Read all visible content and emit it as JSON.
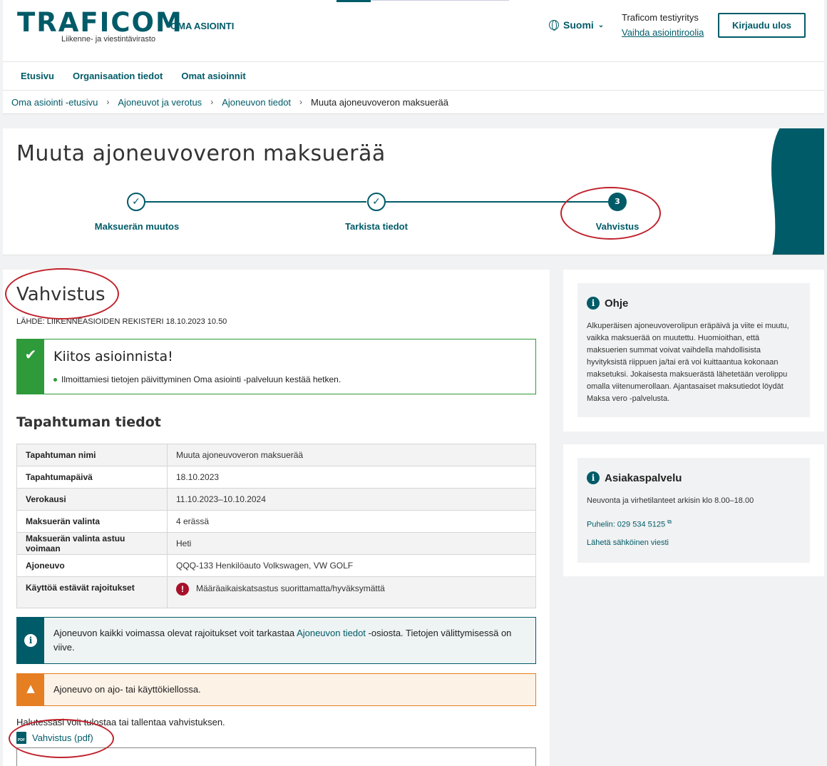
{
  "header": {
    "logo_text": "TRAFICOM",
    "logo_subtitle": "Liikenne- ja viestintävirasto",
    "app_name": "OMA ASIOINTI",
    "language": "Suomi",
    "user_company": "Traficom testiyritys",
    "switch_role_link": "Vaihda asiointiroolia",
    "logout_button": "Kirjaudu ulos"
  },
  "nav": {
    "items": [
      {
        "label": "Etusivu"
      },
      {
        "label": "Organisaation tiedot"
      },
      {
        "label": "Omat asioinnit"
      }
    ]
  },
  "breadcrumb": {
    "items": [
      {
        "label": "Oma asiointi -etusivu"
      },
      {
        "label": "Ajoneuvot ja verotus"
      },
      {
        "label": "Ajoneuvon tiedot"
      }
    ],
    "current": "Muuta ajoneuvoveron maksuerää"
  },
  "hero": {
    "title": "Muuta ajoneuvoveron maksuerää",
    "steps": [
      {
        "label": "Maksuerän muutos",
        "state": "done"
      },
      {
        "label": "Tarkista tiedot",
        "state": "done"
      },
      {
        "label": "Vahvistus",
        "state": "current",
        "number": "3"
      }
    ]
  },
  "main": {
    "title": "Vahvistus",
    "source": "LÄHDE: LIIKENNEASIOIDEN REKISTERI 18.10.2023 10.50",
    "success": {
      "title": "Kiitos asioinnista!",
      "message": "Ilmoittamiesi tietojen päivittyminen Oma asiointi -palveluun kestää hetken."
    },
    "section_title": "Tapahtuman tiedot",
    "details": [
      {
        "key": "Tapahtuman nimi",
        "value": "Muuta ajoneuvoveron maksuerää"
      },
      {
        "key": "Tapahtumapäivä",
        "value": "18.10.2023"
      },
      {
        "key": "Verokausi",
        "value": "11.10.2023–10.10.2024"
      },
      {
        "key": "Maksuerän valinta",
        "value": "4 erässä"
      },
      {
        "key": "Maksuerän valinta astuu voimaan",
        "value": "Heti"
      },
      {
        "key": "Ajoneuvo",
        "value": "QQQ-133 Henkilöauto Volkswagen, VW GOLF"
      },
      {
        "key": "Käyttöä estävät rajoitukset",
        "value": "Määräaikaiskatsastus suorittamatta/hyväksymättä"
      }
    ],
    "info": {
      "text_before": "Ajoneuvon kaikki voimassa olevat rajoitukset voit tarkastaa ",
      "link": "Ajoneuvon tiedot",
      "text_after": " -osiosta. Tietojen välittymisessä on viive."
    },
    "warning": "Ajoneuvo on ajo- tai käyttökiellossa.",
    "print_text": "Halutessasi voit tulostaa tai tallentaa vahvistuksen.",
    "pdf_link": "Vahvistus (pdf)",
    "pdf_icon_label": "PDF"
  },
  "sidebar": {
    "help": {
      "title": "Ohje",
      "body": "Alkuperäisen ajoneuvoverolipun eräpäivä ja viite ei muutu, vaikka maksuerää on muutettu. Huomioithan, että maksuerien summat voivat vaihdella mahdollisista hyvityksistä riippuen ja/tai erä voi kuittaantua kokonaan maksetuksi. Jokaisesta maksuerästä lähetetään verolippu omalla viitenumerollaan. Ajantasaiset maksutiedot löydät Maksa vero -palvelusta."
    },
    "support": {
      "title": "Asiakaspalvelu",
      "hours": "Neuvonta ja virhetilanteet arkisin klo 8.00–18.00",
      "phone_link": "Puhelin: 029 534 5125",
      "email_link": "Lähetä sähköinen viesti"
    }
  },
  "colors": {
    "primary": "#005b68",
    "success": "#2e9a3a",
    "warning": "#e67e22",
    "error": "#a8102a",
    "annotation": "#c0212b"
  }
}
